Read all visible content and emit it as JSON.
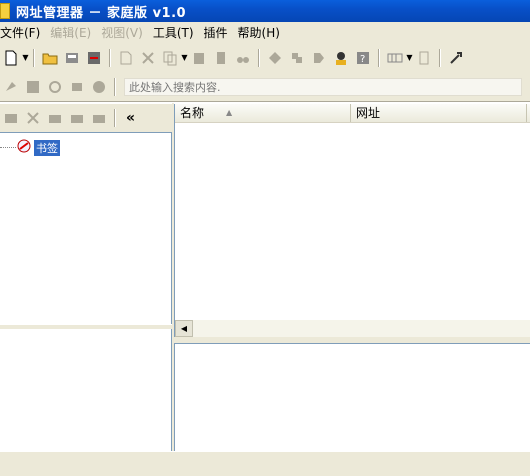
{
  "window": {
    "title": "网址管理器 － 家庭版 v1.0"
  },
  "menu": {
    "items": [
      {
        "label": "文件(F)",
        "enabled": true
      },
      {
        "label": "编辑(E)",
        "enabled": false
      },
      {
        "label": "视图(V)",
        "enabled": false
      },
      {
        "label": "工具(T)",
        "enabled": true
      },
      {
        "label": "插件",
        "enabled": true
      },
      {
        "label": "帮助(H)",
        "enabled": true
      }
    ]
  },
  "search": {
    "placeholder": "此处输入搜索内容."
  },
  "tree": {
    "root_label": "书签"
  },
  "list": {
    "columns": [
      {
        "label": "名称"
      },
      {
        "label": "网址"
      }
    ],
    "sort_indicator": "▲"
  },
  "left_toolbar": {
    "collapse_label": "«"
  },
  "colors": {
    "title_bar": "#0a5fdc",
    "selection": "#316ac5",
    "chrome": "#ece9d8"
  }
}
